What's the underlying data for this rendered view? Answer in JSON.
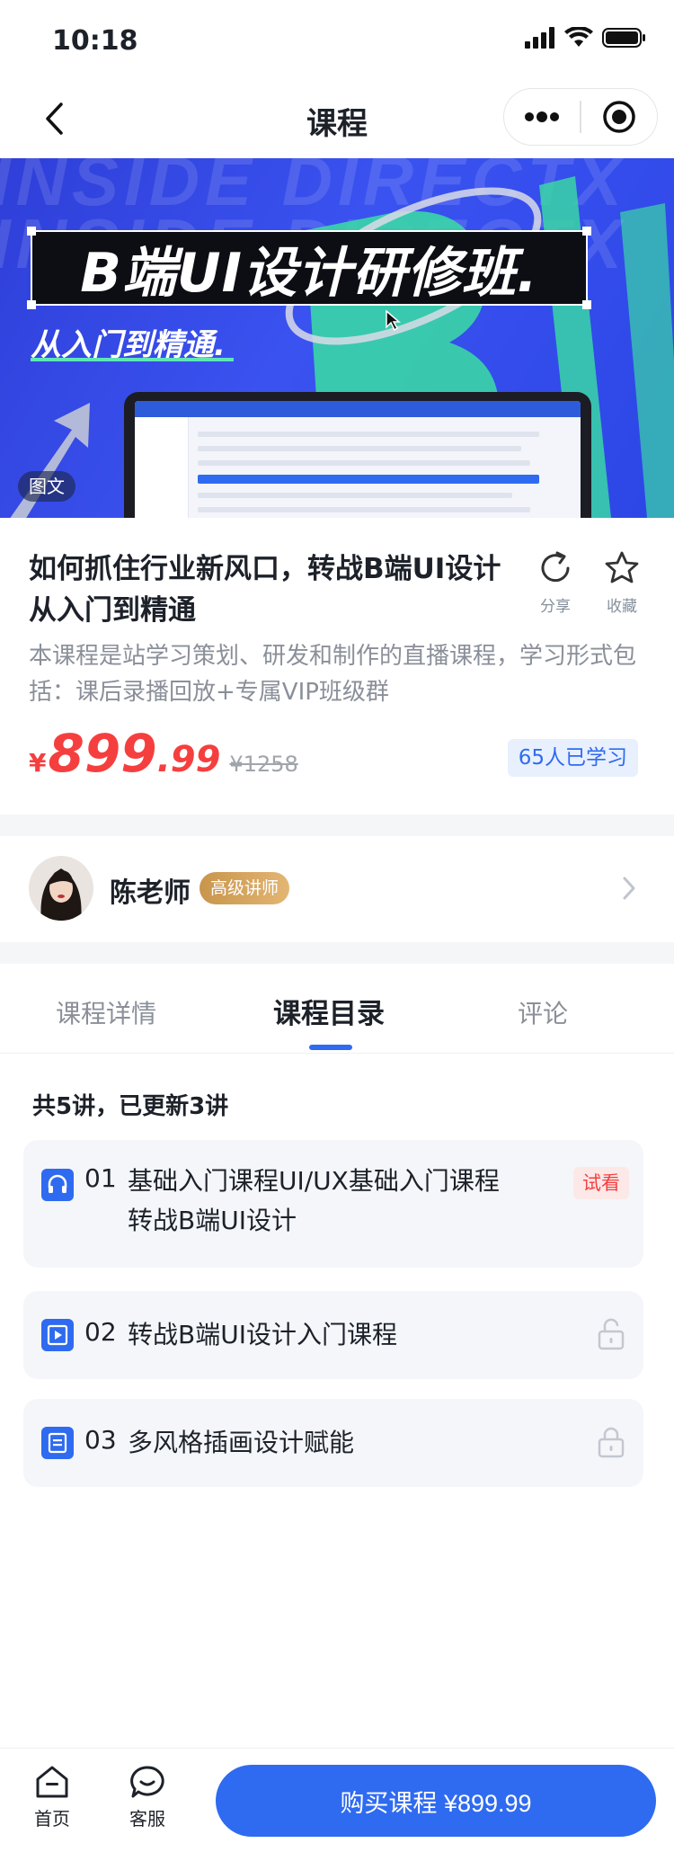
{
  "status_bar": {
    "time": "10:18"
  },
  "nav": {
    "title": "课程"
  },
  "banner": {
    "bg_text": "INSIDE DIRECTX",
    "title": "B端UI设计研修班.",
    "subtitle": "从入门到精通.",
    "tag": "图文"
  },
  "course": {
    "title": "如何抓住行业新风口，转战B端UI设计从入门到精通",
    "share_label": "分享",
    "favorite_label": "收藏",
    "description": "本课程是站学习策划、研发和制作的直播课程，学习形式包括：课后录播回放+专属VIP班级群",
    "price_symbol": "¥",
    "price_integer": "899",
    "price_decimal": ".99",
    "original_price": "¥1258",
    "learned_count": "65人已学习"
  },
  "teacher": {
    "name": "陈老师",
    "badge": "高级讲师"
  },
  "tabs": [
    {
      "label": "课程详情",
      "active": false
    },
    {
      "label": "课程目录",
      "active": true
    },
    {
      "label": "评论",
      "active": false
    }
  ],
  "catalog": {
    "summary": "共5讲，已更新3讲",
    "lessons": [
      {
        "number": "01",
        "title_line1": "基础入门课程UI/UX基础入门课程",
        "title_line2": "转战B端UI设计",
        "icon": "headphones-icon",
        "badge": "试看"
      },
      {
        "number": "02",
        "title_line1": "转战B端UI设计入门课程",
        "icon": "play-video-icon",
        "status": "unlocked"
      },
      {
        "number": "03",
        "title_line1": "多风格插画设计赋能",
        "icon": "document-icon",
        "status": "locked"
      }
    ]
  },
  "bottom_bar": {
    "home_label": "首页",
    "service_label": "客服",
    "buy_label": "购买课程 ¥899.99"
  },
  "colors": {
    "primary": "#2f6bf0",
    "price": "#f53f3f",
    "banner_green": "#3ad6a6"
  }
}
